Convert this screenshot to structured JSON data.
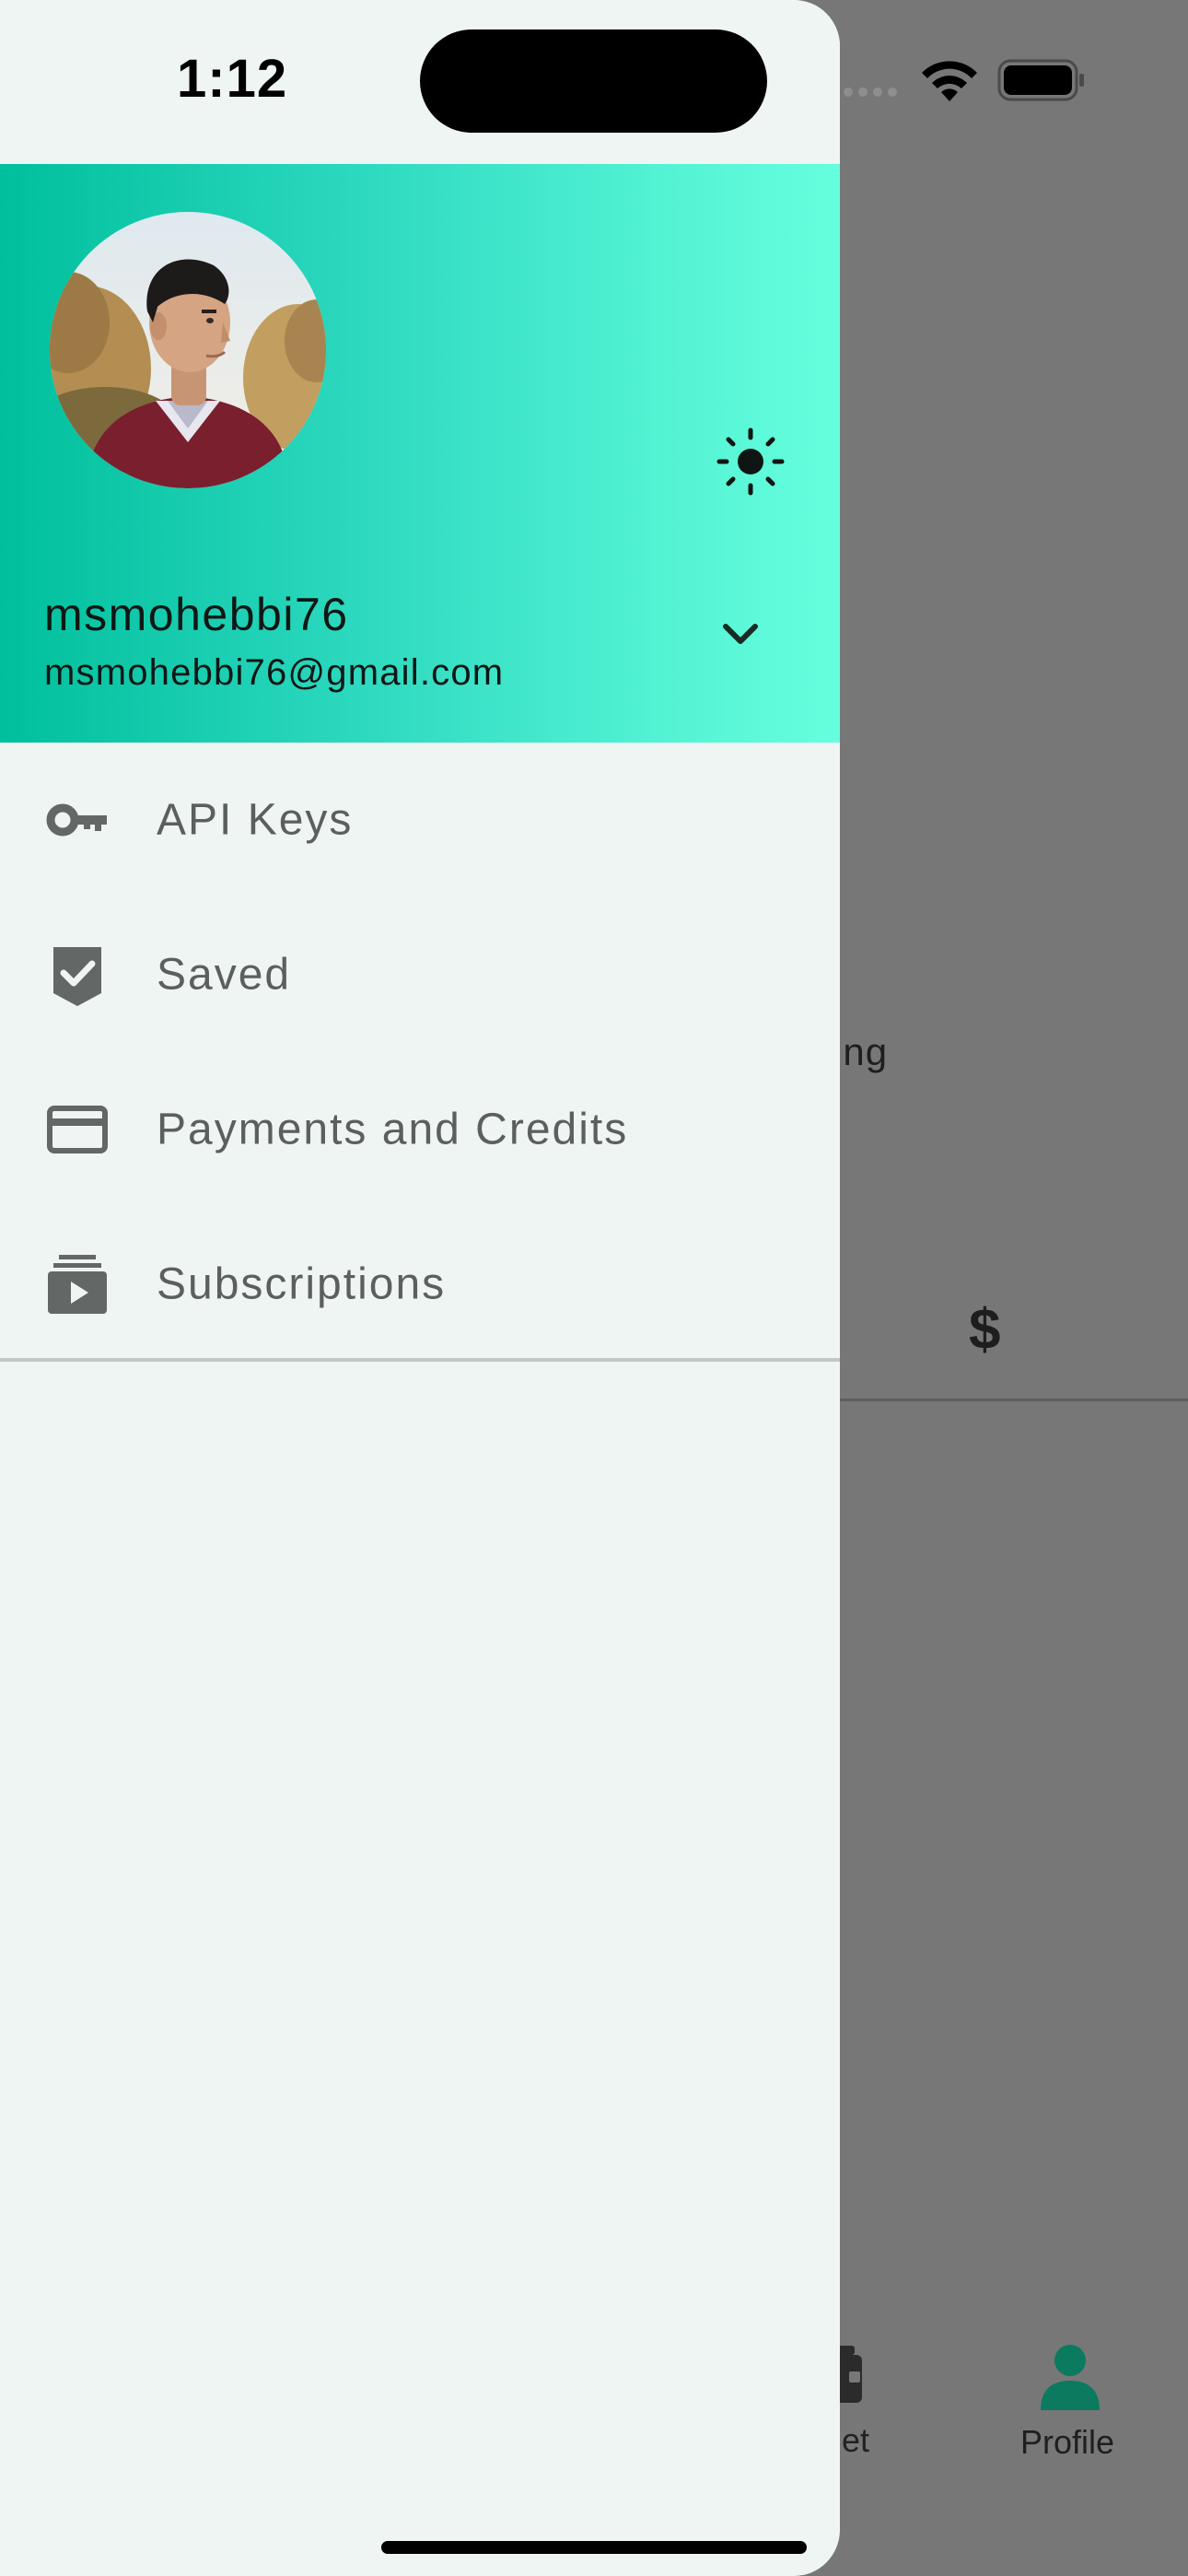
{
  "status_bar": {
    "time": "1:12"
  },
  "drawer_header": {
    "username": "msmohebbi76",
    "email": "msmohebbi76@gmail.com",
    "gradient_colors": [
      "#00bf9c",
      "#66ffde"
    ],
    "theme_icon": "sun-icon",
    "expand_icon": "chevron-down-icon"
  },
  "menu": {
    "items": [
      {
        "label": "API Keys",
        "icon": "key-icon"
      },
      {
        "label": "Saved",
        "icon": "bookmark-check-icon"
      },
      {
        "label": "Payments and Credits",
        "icon": "credit-card-icon"
      },
      {
        "label": "Subscriptions",
        "icon": "subscriptions-icon"
      }
    ]
  },
  "background": {
    "partial_text": "ing",
    "currency_symbol": "$",
    "nav": {
      "wallet_label_partial": "let",
      "profile_label": "Profile",
      "active_color": "#0b7a5f"
    }
  }
}
